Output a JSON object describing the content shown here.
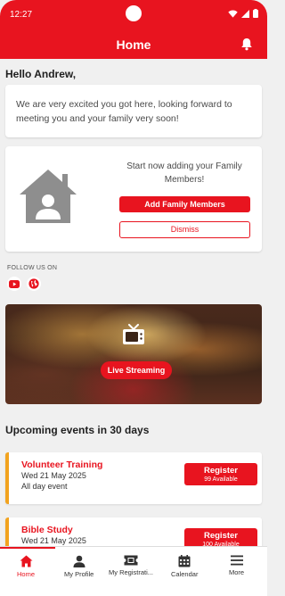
{
  "status": {
    "time": "12:27"
  },
  "header": {
    "title": "Home"
  },
  "greeting": "Hello Andrew,",
  "welcome": {
    "text": "We are very excited you got here, looking forward to meeting you and your family very soon!"
  },
  "family": {
    "prompt": "Start now adding your Family Members!",
    "add_label": "Add Family Members",
    "dismiss_label": "Dismiss"
  },
  "follow": {
    "label": "FOLLOW US ON"
  },
  "stream": {
    "label": "Live Streaming"
  },
  "events": {
    "heading": "Upcoming events in 30 days",
    "items": [
      {
        "title": "Volunteer Training",
        "date": "Wed 21 May  2025",
        "extra": "All day event",
        "register_label": "Register",
        "available": "99 Available"
      },
      {
        "title": "Bible Study",
        "date": "Wed 21 May  2025",
        "extra": "",
        "register_label": "Register",
        "available": "100 Available"
      }
    ]
  },
  "nav": {
    "items": [
      {
        "label": "Home",
        "icon": "home-icon",
        "active": true
      },
      {
        "label": "My Profile",
        "icon": "person-icon",
        "active": false
      },
      {
        "label": "My Registrati...",
        "icon": "ticket-icon",
        "active": false
      },
      {
        "label": "Calendar",
        "icon": "calendar-icon",
        "active": false
      },
      {
        "label": "More",
        "icon": "menu-icon",
        "active": false
      }
    ]
  },
  "colors": {
    "primary": "#e8141f",
    "event_accent": "#f2a31f",
    "background": "#f0f0f0"
  }
}
